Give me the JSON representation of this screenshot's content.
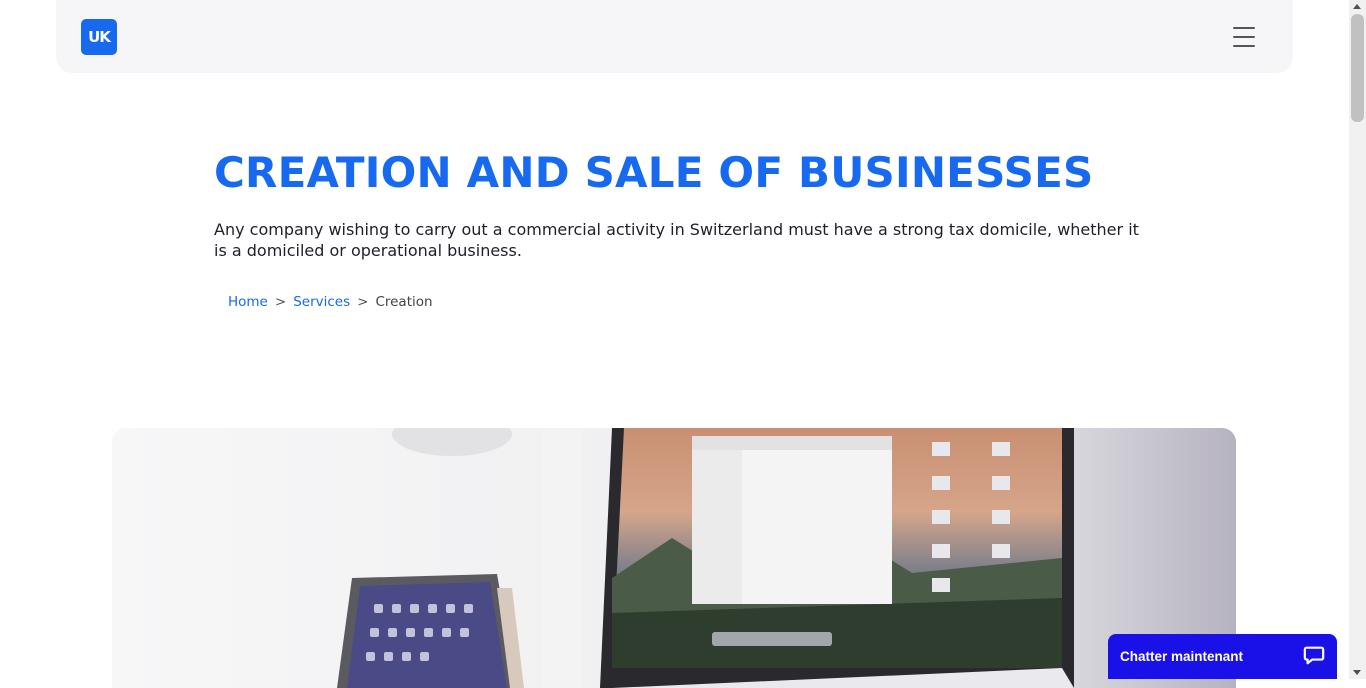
{
  "header": {
    "logo_text": "UK",
    "menu_icon": "hamburger-icon"
  },
  "hero": {
    "title": "CREATION AND SALE OF BUSINESSES",
    "description": "Any company wishing to carry out a commercial activity in Switzerland must have a strong tax domicile, whether it is a domiciled or operational business."
  },
  "breadcrumb": {
    "home": "Home",
    "separator": ">",
    "services": "Services",
    "current": "Creation"
  },
  "chat": {
    "label": "Chatter maintenant",
    "icon": "chat-bubble-icon"
  },
  "colors": {
    "accent": "#1769f0",
    "chat": "#1a10e8",
    "header_bg": "#f6f6f8"
  }
}
